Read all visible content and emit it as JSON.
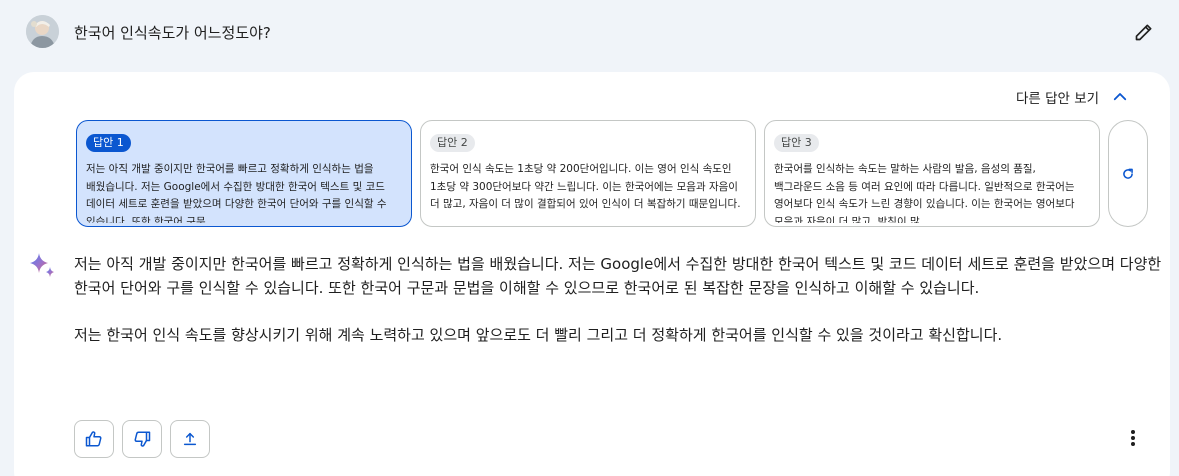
{
  "query": {
    "text": "한국어 인식속도가 어느정도야?"
  },
  "drafts_toggle": {
    "label": "다른 답안 보기"
  },
  "drafts": [
    {
      "label": "답안 1",
      "text": "저는 아직 개발 중이지만 한국어를 빠르고 정확하게 인식하는 법을 배웠습니다. 저는 Google에서 수집한 방대한 한국어 텍스트 및 코드 데이터 세트로 훈련을 받았으며 다양한 한국어 단어와 구를 인식할 수 있습니다. 또한 한국어 구문"
    },
    {
      "label": "답안 2",
      "text": "한국어 인식 속도는 1초당 약 200단어입니다. 이는 영어 인식 속도인 1초당 약 300단어보다 약간 느립니다. 이는 한국어에는 모음과 자음이 더 많고, 자음이 더 많이 결합되어 있어 인식이 더 복잡하기 때문입니다."
    },
    {
      "label": "답안 3",
      "text": "한국어를 인식하는 속도는 말하는 사람의 발음, 음성의 품질, 백그라운드 소음 등 여러 요인에 따라 다릅니다. 일반적으로 한국어는 영어보다 인식 속도가 느린 경향이 있습니다. 이는 한국어는 영어보다 모음과 자음이 더 많고, 받침이 많"
    }
  ],
  "response": {
    "paragraphs": [
      "저는 아직 개발 중이지만 한국어를 빠르고 정확하게 인식하는 법을 배웠습니다. 저는 Google에서 수집한 방대한 한국어 텍스트 및 코드 데이터 세트로 훈련을 받았으며 다양한 한국어 단어와 구를 인식할 수 있습니다. 또한 한국어 구문과 문법을 이해할 수 있으므로 한국어로 된 복잡한 문장을 인식하고 이해할 수 있습니다.",
      "저는 한국어 인식 속도를 향상시키기 위해 계속 노력하고 있으며 앞으로도 더 빨리 그리고 더 정확하게 한국어를 인식할 수 있을 것이라고 확신합니다."
    ]
  },
  "icons": {
    "edit": "pencil-icon",
    "collapse": "chevron-up-icon",
    "regenerate": "refresh-icon",
    "model": "sparkle-icon",
    "like": "thumbs-up-icon",
    "dislike": "thumbs-down-icon",
    "share": "share-icon",
    "more": "more-vert-icon"
  },
  "colors": {
    "page_bg": "#f0f4f9",
    "accent": "#0b57d0",
    "active_draft_bg": "#d3e3fd"
  }
}
